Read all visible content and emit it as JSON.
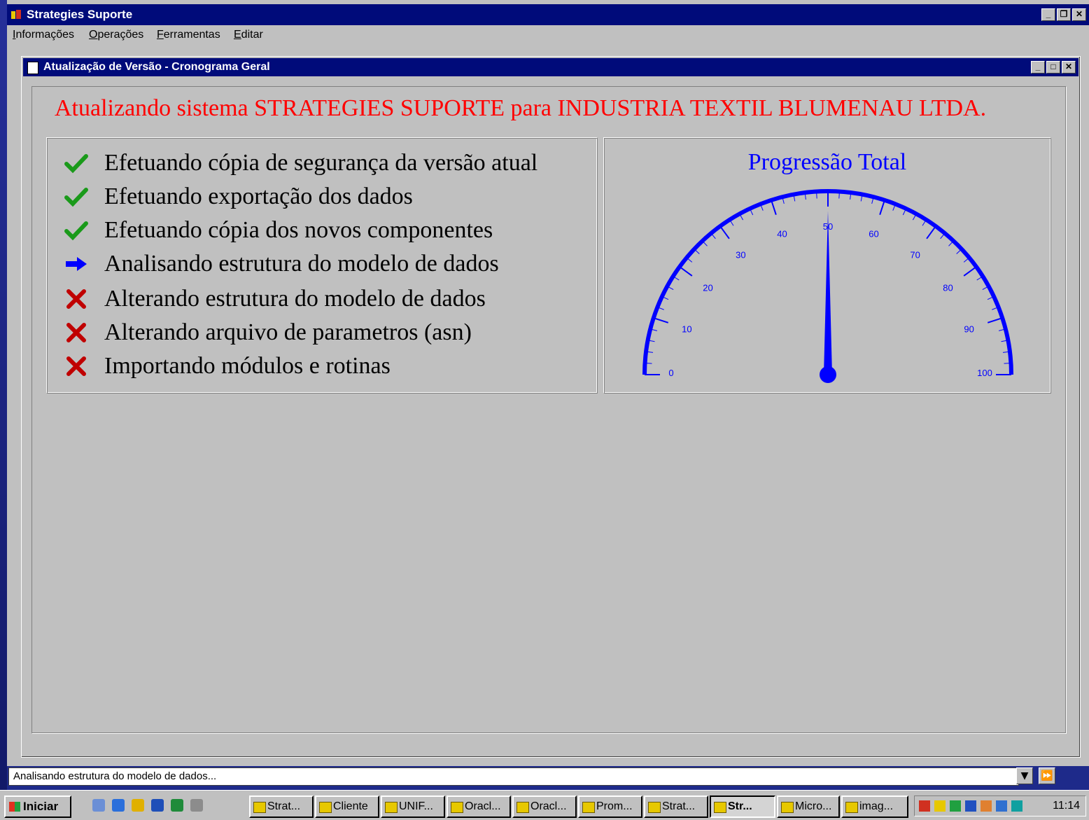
{
  "app": {
    "title": "Strategies Suporte"
  },
  "menu": [
    "Informações",
    "Operações",
    "Ferramentas",
    "Editar"
  ],
  "child_window": {
    "title": "Atualização de Versão - Cronograma Geral"
  },
  "headline": "Atualizando sistema STRATEGIES SUPORTE para INDUSTRIA TEXTIL BLUMENAU LTDA.",
  "steps": [
    {
      "label": "Efetuando cópia de segurança da versão atual",
      "status": "done",
      "icon": "check-icon"
    },
    {
      "label": "Efetuando exportação dos dados",
      "status": "done",
      "icon": "check-icon"
    },
    {
      "label": "Efetuando cópia dos novos componentes",
      "status": "done",
      "icon": "check-icon"
    },
    {
      "label": "Analisando estrutura do modelo de dados",
      "status": "in-progress",
      "icon": "arrow-right-icon"
    },
    {
      "label": "Alterando estrutura do modelo de dados",
      "status": "pending",
      "icon": "x-icon"
    },
    {
      "label": "Alterando arquivo de parametros (asn)",
      "status": "pending",
      "icon": "x-icon"
    },
    {
      "label": "Importando módulos e rotinas",
      "status": "pending",
      "icon": "x-icon"
    }
  ],
  "gauge": {
    "title": "Progressão Total",
    "min": 0,
    "max": 100,
    "value": 50,
    "labels": [
      "0",
      "10",
      "20",
      "30",
      "40",
      "50",
      "60",
      "70",
      "80",
      "90",
      "100"
    ],
    "color": "#0000ff"
  },
  "status_bar": {
    "text": "Analisando estrutura do modelo de dados..."
  },
  "taskbar": {
    "start_label": "Iniciar",
    "tasks": [
      "Strat...",
      "Cliente",
      "UNIF...",
      "Oracl...",
      "Oracl...",
      "Prom...",
      "Strat...",
      "Str...",
      "Micro...",
      "imag..."
    ],
    "active_task": 7,
    "clock": "11:14"
  },
  "colors": {
    "title_bar": "#000b7a",
    "headline": "#ff0000",
    "check": "#1a9a1a",
    "cross": "#c00000",
    "arrow": "#0000ff"
  }
}
